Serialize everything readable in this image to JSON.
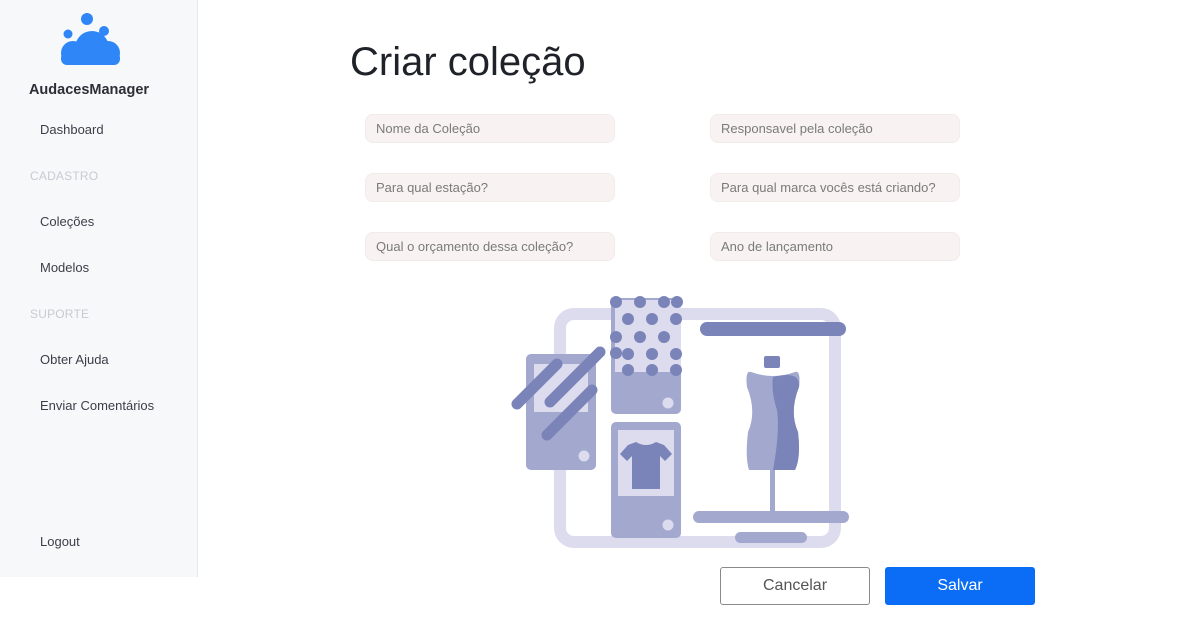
{
  "app": {
    "brand": "AudacesManager"
  },
  "sidebar": {
    "dashboard": "Dashboard",
    "section_cadastro": "CADASTRO",
    "colecoes": "Coleções",
    "modelos": "Modelos",
    "section_suporte": "SUPORTE",
    "obter_ajuda": "Obter Ajuda",
    "enviar_comentarios": "Enviar Comentários",
    "logout": "Logout"
  },
  "page": {
    "title": "Criar coleção"
  },
  "form": {
    "nome_placeholder": "Nome da Coleção",
    "responsavel_placeholder": "Responsavel pela coleção",
    "estacao_placeholder": "Para qual estação?",
    "marca_placeholder": "Para qual marca vocês está criando?",
    "orcamento_placeholder": "Qual o orçamento dessa coleção?",
    "ano_placeholder": "Ano de lançamento"
  },
  "actions": {
    "cancel": "Cancelar",
    "save": "Salvar"
  },
  "colors": {
    "accent": "#0b6cf5",
    "logo": "#2f86f6",
    "illustration_dark": "#7b84b8",
    "illustration_mid": "#a3a8cf",
    "illustration_light": "#dcdcee"
  },
  "icons": {
    "logo": "cloud-logo-icon",
    "illustration": "fashion-collection-illustration"
  }
}
